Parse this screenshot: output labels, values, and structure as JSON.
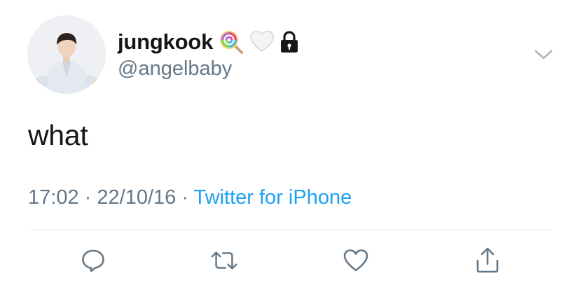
{
  "tweet": {
    "display_name": "jungkook",
    "handle": "@angelbaby",
    "name_emojis": [
      "lollipop-icon",
      "white-heart-icon",
      "lock-icon"
    ],
    "text": "what",
    "time": "17:02",
    "separator": "·",
    "date": "22/10/16",
    "source": "Twitter for iPhone"
  },
  "actions": [
    "reply-icon",
    "retweet-icon",
    "like-icon",
    "share-icon"
  ],
  "colors": {
    "text": "#14171a",
    "secondary": "#657786",
    "link": "#1da1f2",
    "divider": "#e1e8ed",
    "icon": "#657786"
  }
}
